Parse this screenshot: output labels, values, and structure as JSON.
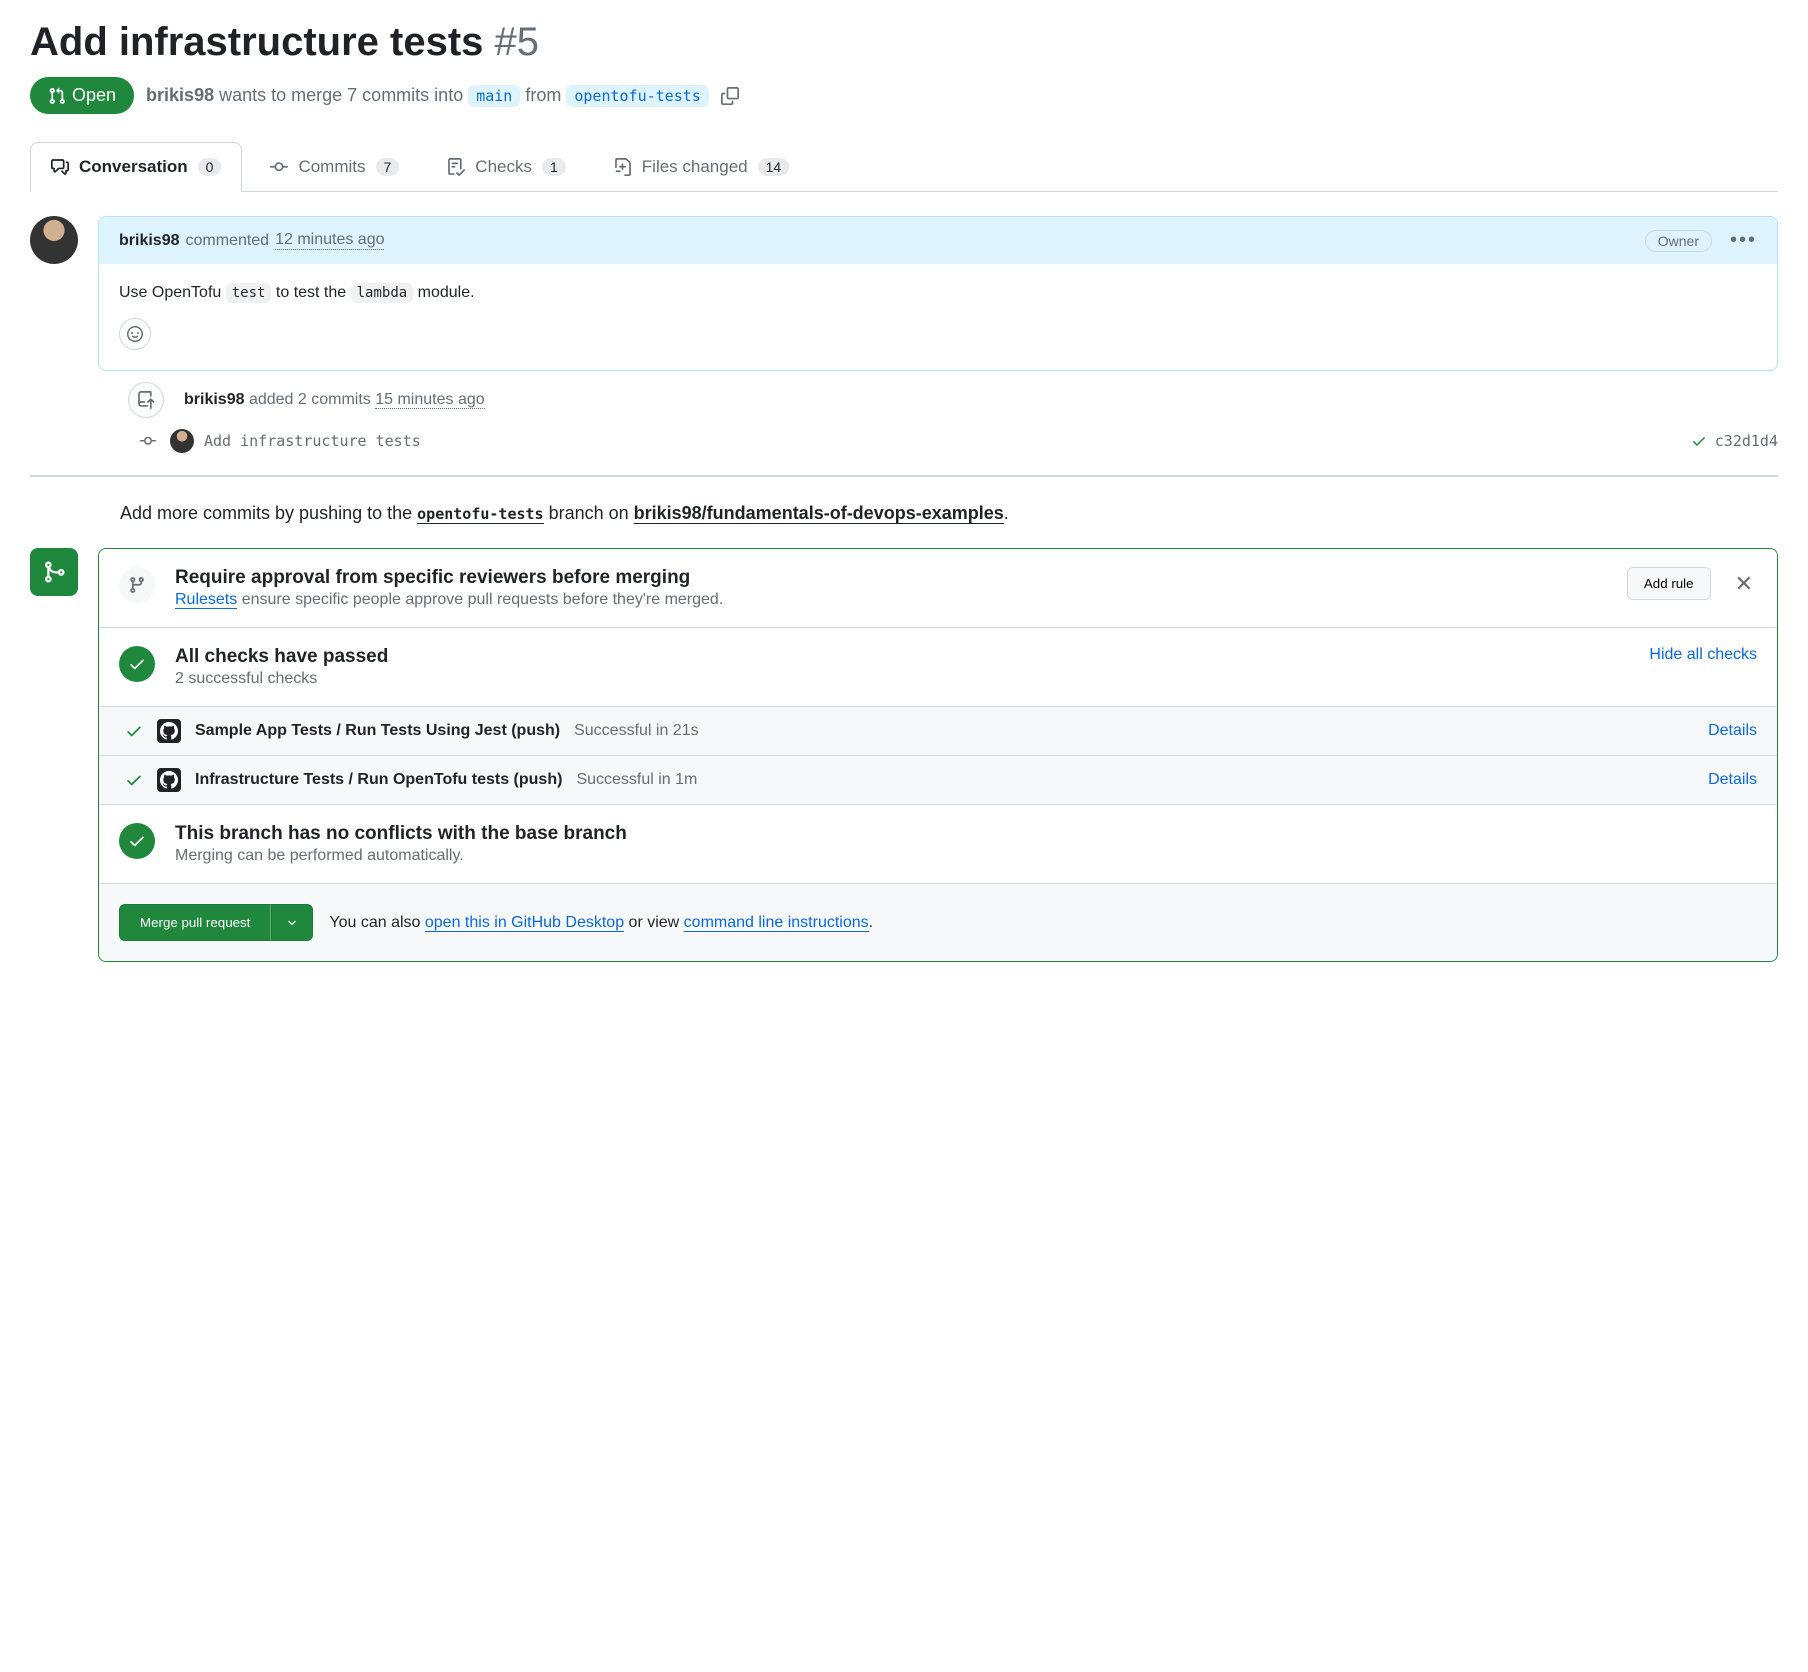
{
  "title": {
    "text": "Add infrastructure tests",
    "number": "#5"
  },
  "status": {
    "state": "Open",
    "author": "brikis98",
    "merge_text_1": "wants to merge 7 commits into",
    "base_branch": "main",
    "merge_text_2": "from",
    "head_branch": "opentofu-tests"
  },
  "tabs": {
    "conversation": {
      "label": "Conversation",
      "count": "0"
    },
    "commits": {
      "label": "Commits",
      "count": "7"
    },
    "checks": {
      "label": "Checks",
      "count": "1"
    },
    "files": {
      "label": "Files changed",
      "count": "14"
    }
  },
  "comment": {
    "author": "brikis98",
    "action": "commented",
    "time": "12 minutes ago",
    "owner_badge": "Owner",
    "body_pre": "Use OpenTofu ",
    "body_code1": "test",
    "body_mid": " to test the ",
    "body_code2": "lambda",
    "body_post": " module."
  },
  "event": {
    "author": "brikis98",
    "action": "added 2 commits",
    "time": "15 minutes ago"
  },
  "commit": {
    "message": "Add infrastructure tests",
    "sha": "c32d1d4"
  },
  "push_hint": {
    "pre": "Add more commits by pushing to the ",
    "branch": "opentofu-tests",
    "mid": " branch on ",
    "repo": "brikis98/fundamentals-of-devops-examples",
    "post": "."
  },
  "approval": {
    "title": "Require approval from specific reviewers before merging",
    "link": "Rulesets",
    "desc": " ensure specific people approve pull requests before they're merged.",
    "button": "Add rule"
  },
  "checks_passed": {
    "title": "All checks have passed",
    "subtitle": "2 successful checks",
    "hide": "Hide all checks"
  },
  "check_items": [
    {
      "name": "Sample App Tests / Run Tests Using Jest (push)",
      "status": "Successful in 21s",
      "details": "Details"
    },
    {
      "name": "Infrastructure Tests / Run OpenTofu tests (push)",
      "status": "Successful in 1m",
      "details": "Details"
    }
  ],
  "no_conflicts": {
    "title": "This branch has no conflicts with the base branch",
    "subtitle": "Merging can be performed automatically."
  },
  "merge_footer": {
    "button": "Merge pull request",
    "text_pre": "You can also ",
    "link1": "open this in GitHub Desktop",
    "text_mid": " or view ",
    "link2": "command line instructions",
    "text_post": "."
  }
}
